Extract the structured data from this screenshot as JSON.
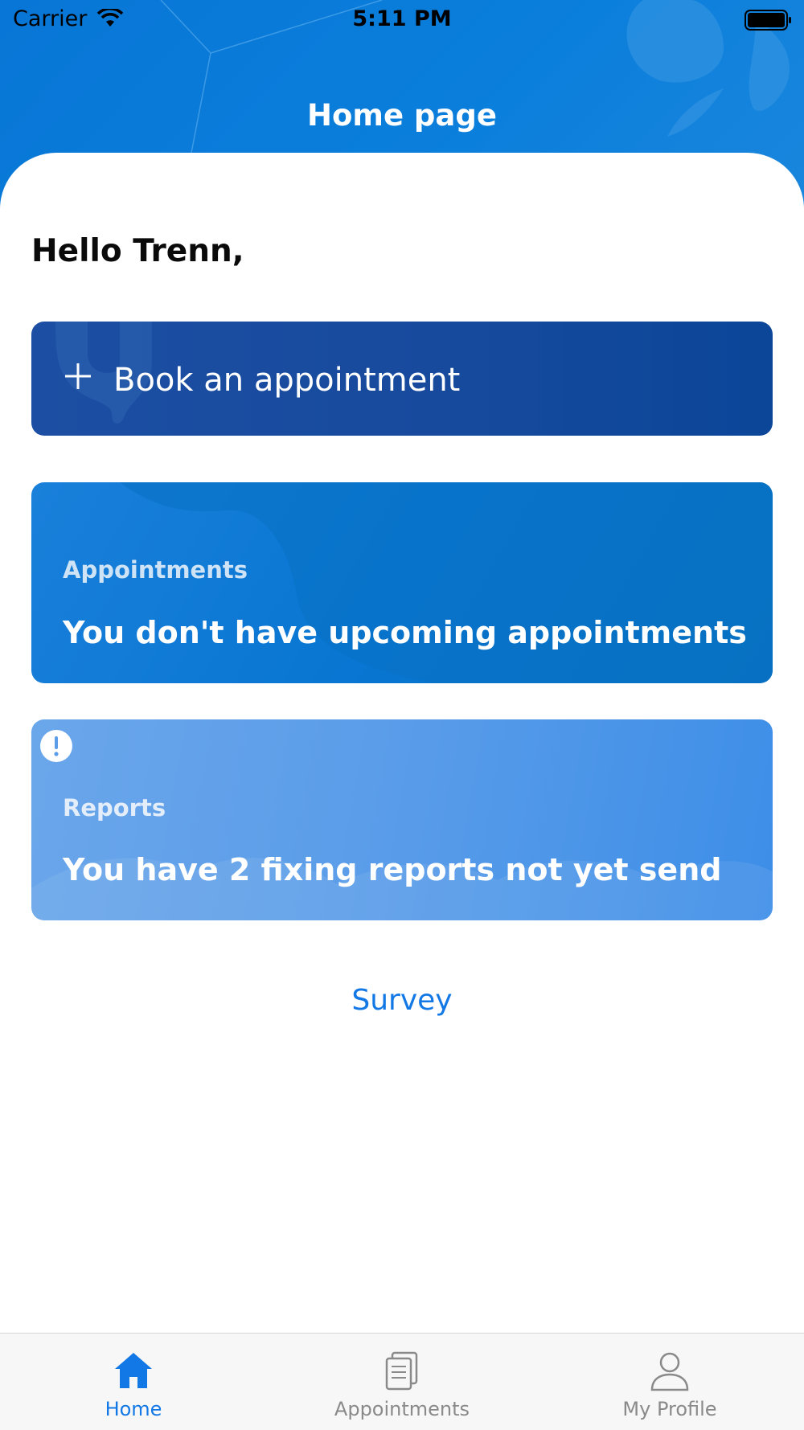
{
  "status_bar": {
    "carrier": "Carrier",
    "time": "5:11 PM"
  },
  "header": {
    "title": "Home page"
  },
  "greeting": "Hello Trenn,",
  "book_card": {
    "label": "Book an appointment",
    "icon": "plus-icon"
  },
  "appointments_card": {
    "label": "Appointments",
    "text": "You don't have upcoming appointments"
  },
  "reports_card": {
    "label": "Reports",
    "text": "You have 2 fixing reports not yet send",
    "icon": "alert-icon"
  },
  "survey_link": "Survey",
  "tab_bar": {
    "tabs": [
      {
        "label": "Home",
        "icon": "home-icon",
        "active": true
      },
      {
        "label": "Appointments",
        "icon": "documents-icon",
        "active": false
      },
      {
        "label": "My Profile",
        "icon": "person-icon",
        "active": false
      }
    ]
  },
  "colors": {
    "primary": "#1178e6",
    "header_blue": "#0b7fdc",
    "book_card": "#174a9d",
    "appointments_card": "#0876d2",
    "reports_card": "#5b9de9",
    "tab_inactive": "#8a8a8a"
  }
}
